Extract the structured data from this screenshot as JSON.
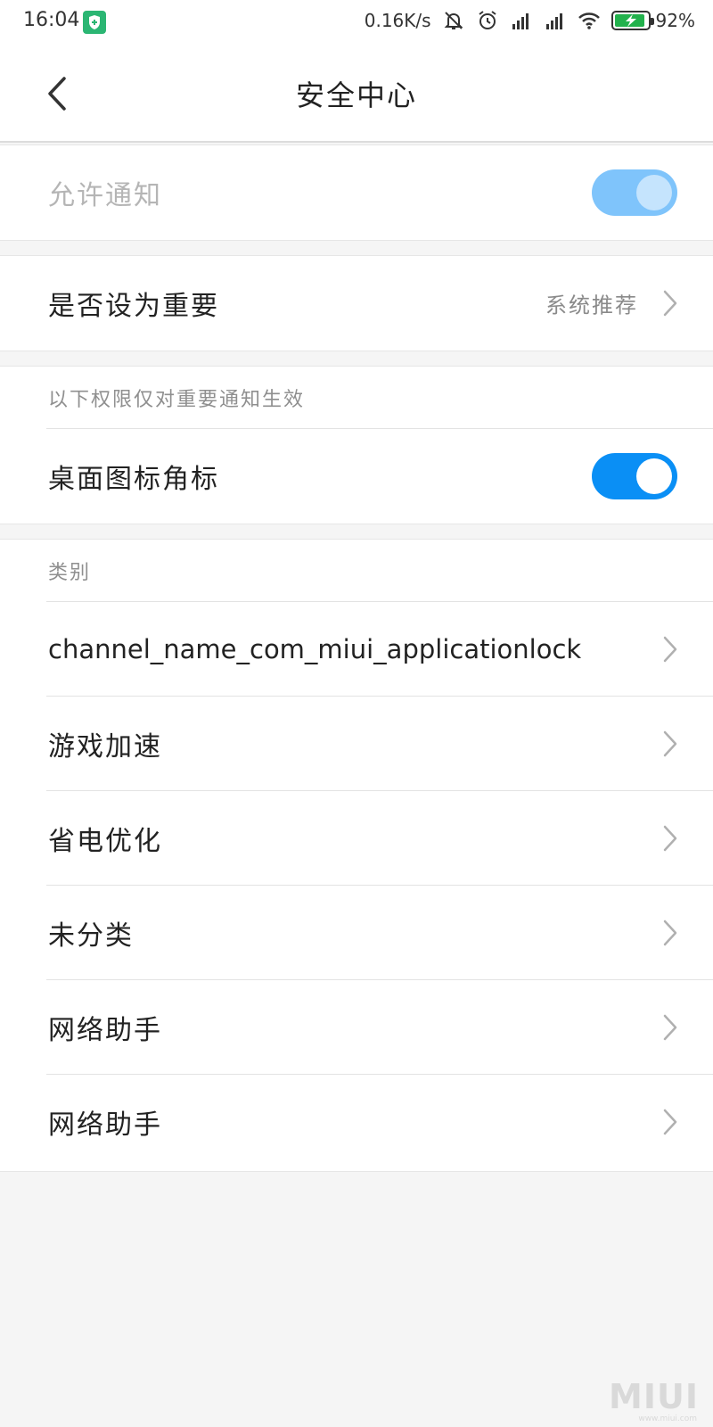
{
  "status_bar": {
    "time": "16:04",
    "net_speed": "0.16K/s",
    "battery_pct": "92%",
    "battery_level": 0.92
  },
  "header": {
    "title": "安全中心"
  },
  "allow_notifications": {
    "label": "允许通知",
    "enabled": true,
    "disabled_look": true
  },
  "importance": {
    "label": "是否设为重要",
    "value": "系统推荐"
  },
  "important_section": {
    "header": "以下权限仅对重要通知生效",
    "badge_label": "桌面图标角标",
    "badge_enabled": true
  },
  "categories": {
    "header": "类别",
    "items": [
      {
        "label": "channel_name_com_miui_applicationlock"
      },
      {
        "label": "游戏加速"
      },
      {
        "label": "省电优化"
      },
      {
        "label": "未分类"
      },
      {
        "label": "网络助手"
      },
      {
        "label": "网络助手"
      }
    ]
  },
  "watermark": {
    "text": "MIUI",
    "sub": "www.miui.com"
  },
  "colors": {
    "toggle_on": "#0a8ff5",
    "toggle_disabled": "#7fc4fb",
    "app_icon": "#2bb673",
    "battery": "#22b14c"
  }
}
